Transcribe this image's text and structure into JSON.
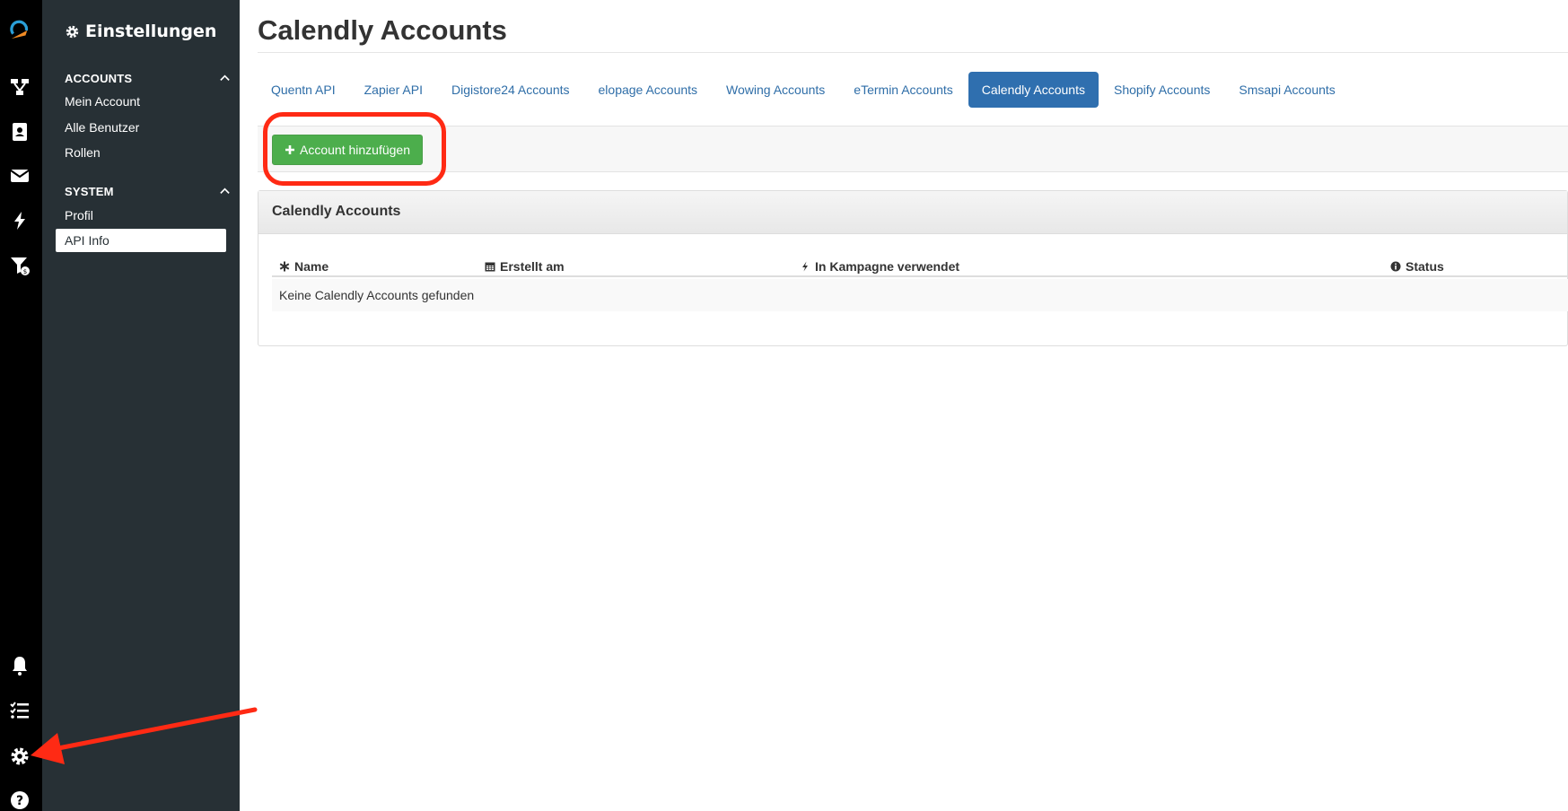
{
  "app": {
    "settings_title": "Einstellungen"
  },
  "sidebar": {
    "sections": [
      {
        "label": "ACCOUNTS",
        "items": [
          "Mein Account",
          "Alle Benutzer",
          "Rollen"
        ]
      },
      {
        "label": "SYSTEM",
        "items": [
          "Profil",
          "API Info"
        ]
      }
    ],
    "active_item": "API Info"
  },
  "page": {
    "title": "Calendly Accounts"
  },
  "tabs": [
    {
      "label": "Quentn API",
      "active": false
    },
    {
      "label": "Zapier API",
      "active": false
    },
    {
      "label": "Digistore24 Accounts",
      "active": false
    },
    {
      "label": "elopage Accounts",
      "active": false
    },
    {
      "label": "Wowing Accounts",
      "active": false
    },
    {
      "label": "eTermin Accounts",
      "active": false
    },
    {
      "label": "Calendly Accounts",
      "active": true
    },
    {
      "label": "Shopify Accounts",
      "active": false
    },
    {
      "label": "Smsapi Accounts",
      "active": false
    }
  ],
  "toolbar": {
    "add_label": "Account hinzufügen"
  },
  "panel": {
    "title": "Calendly Accounts",
    "columns": [
      {
        "label": "Name",
        "icon": "asterisk-icon"
      },
      {
        "label": "Erstellt am",
        "icon": "calendar-icon"
      },
      {
        "label": "In Kampagne verwendet",
        "icon": "bolt-icon"
      },
      {
        "label": "Status",
        "icon": "info-icon"
      }
    ],
    "empty_text": "Keine Calendly Accounts gefunden"
  },
  "colors": {
    "rail": "#000000",
    "sidebar": "#273035",
    "primary": "#2f6faf",
    "success": "#4cae4c",
    "annotation": "#ff2a14"
  }
}
